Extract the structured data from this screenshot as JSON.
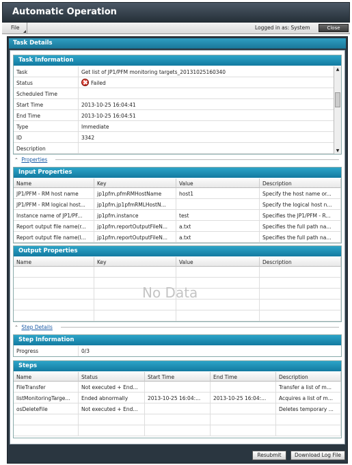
{
  "app": {
    "title": "Automatic Operation"
  },
  "menu": {
    "file": "File",
    "logged_in": "Logged in as: System",
    "close": "Close"
  },
  "dialog": {
    "title": "Task Details"
  },
  "task_info": {
    "title": "Task Information",
    "rows": [
      {
        "key": "Task",
        "value": "Get list of JP1/PFM monitoring targets_20131025160340"
      },
      {
        "key": "Status",
        "value": "Failed"
      },
      {
        "key": "Scheduled Time",
        "value": ""
      },
      {
        "key": "Start Time",
        "value": "2013-10-25 16:04:41"
      },
      {
        "key": "End Time",
        "value": "2013-10-25 16:04:51"
      },
      {
        "key": "Type",
        "value": "Immediate"
      },
      {
        "key": "ID",
        "value": "3342"
      },
      {
        "key": "Description",
        "value": ""
      }
    ]
  },
  "properties_link": "Properties",
  "input_props": {
    "title": "Input Properties",
    "columns": [
      "Name",
      "Key",
      "Value",
      "Description"
    ],
    "rows": [
      [
        "JP1/PFM - RM host name",
        "jp1pfm.pfmRMHostName",
        "host1",
        "Specify the host name or..."
      ],
      [
        "JP1/PFM - RM logical host...",
        "jp1pfm.jp1pfmRMLHostN...",
        "",
        "Specify the logical host n..."
      ],
      [
        "Instance name of JP1/PF...",
        "jp1pfm.instance",
        "test",
        "Specifies the JP1/PFM - R..."
      ],
      [
        "Report output file name(r...",
        "jp1pfm.reportOutputFileN...",
        "a.txt",
        "Specifies the full path na..."
      ],
      [
        "Report output file name(l...",
        "jp1pfm.reportOutputFileN...",
        "a.txt",
        "Specifies the full path na..."
      ]
    ]
  },
  "output_props": {
    "title": "Output Properties",
    "columns": [
      "Name",
      "Key",
      "Value",
      "Description"
    ],
    "empty_text": "No Data"
  },
  "step_details_link": "Step Details",
  "step_info": {
    "title": "Step Information",
    "progress_label": "Progress",
    "progress_value": "0/3"
  },
  "steps": {
    "title": "Steps",
    "columns": [
      "Name",
      "Status",
      "Start Time",
      "End Time",
      "Description"
    ],
    "rows": [
      [
        "FileTransfer",
        "Not executed + End...",
        "",
        "",
        "Transfer a list of m..."
      ],
      [
        "listMonitoringTarge...",
        "Ended abnormally",
        "2013-10-25 16:04:...",
        "2013-10-25 16:04:...",
        "Acquires a list of m..."
      ],
      [
        "osDeleteFile",
        "Not executed + End...",
        "",
        "",
        "Deletes temporary ..."
      ]
    ]
  },
  "buttons": {
    "resubmit": "Resubmit",
    "download": "Download Log File"
  },
  "colors": {
    "header_teal": "#1a87ad",
    "titlebar": "#2f3a44",
    "failed_red": "#c9241a"
  },
  "icons": {
    "status_failed": "failed-x-icon",
    "collapse": "chevron-up-icon"
  }
}
